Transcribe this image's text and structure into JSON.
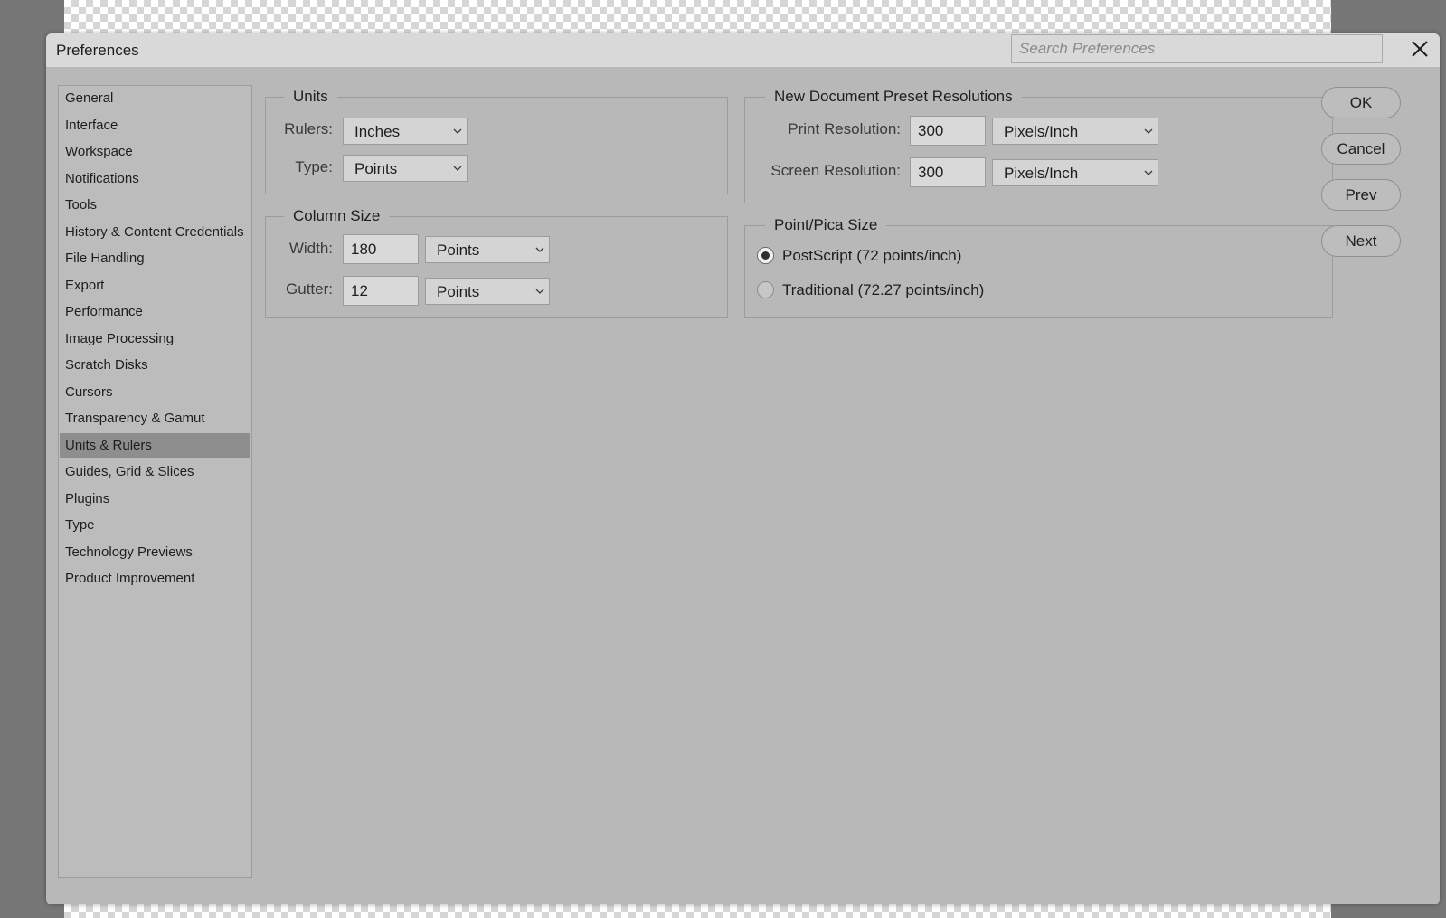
{
  "window": {
    "title": "Preferences",
    "search_placeholder": "Search Preferences"
  },
  "sidebar": {
    "items": [
      {
        "label": "General"
      },
      {
        "label": "Interface"
      },
      {
        "label": "Workspace"
      },
      {
        "label": "Notifications"
      },
      {
        "label": "Tools"
      },
      {
        "label": "History & Content Credentials"
      },
      {
        "label": "File Handling"
      },
      {
        "label": "Export"
      },
      {
        "label": "Performance"
      },
      {
        "label": "Image Processing"
      },
      {
        "label": "Scratch Disks"
      },
      {
        "label": "Cursors"
      },
      {
        "label": "Transparency & Gamut"
      },
      {
        "label": "Units & Rulers",
        "active": true
      },
      {
        "label": "Guides, Grid & Slices"
      },
      {
        "label": "Plugins"
      },
      {
        "label": "Type"
      },
      {
        "label": "Technology Previews"
      },
      {
        "label": "Product Improvement"
      }
    ]
  },
  "units": {
    "title": "Units",
    "rulers_label": "Rulers:",
    "rulers_value": "Inches",
    "type_label": "Type:",
    "type_value": "Points"
  },
  "column_size": {
    "title": "Column Size",
    "width_label": "Width:",
    "width_value": "180",
    "width_unit": "Points",
    "gutter_label": "Gutter:",
    "gutter_value": "12",
    "gutter_unit": "Points"
  },
  "resolutions": {
    "title": "New Document Preset Resolutions",
    "print_label": "Print Resolution:",
    "print_value": "300",
    "print_unit": "Pixels/Inch",
    "screen_label": "Screen Resolution:",
    "screen_value": "300",
    "screen_unit": "Pixels/Inch"
  },
  "point_pica": {
    "title": "Point/Pica Size",
    "options": [
      {
        "label": "PostScript (72 points/inch)",
        "selected": true
      },
      {
        "label": "Traditional (72.27 points/inch)",
        "selected": false
      }
    ]
  },
  "buttons": {
    "ok": "OK",
    "cancel": "Cancel",
    "prev": "Prev",
    "next": "Next"
  },
  "icons": {
    "close": "close-icon",
    "dropdown": "chevron-down-icon"
  },
  "colors": {
    "dialog_bg": "#b8b8b8",
    "titlebar_bg": "#d9d9d9",
    "active_item_bg": "#8e8e8e"
  }
}
